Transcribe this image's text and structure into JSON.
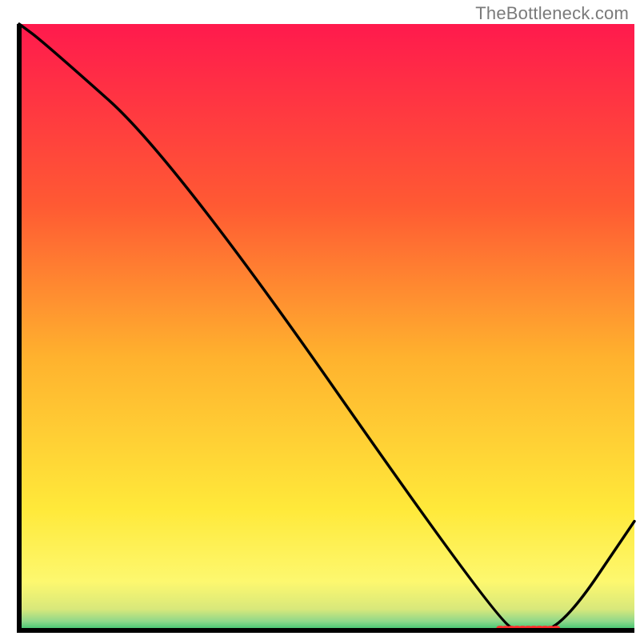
{
  "watermark": "TheBottleneck.com",
  "chart_data": {
    "type": "line",
    "title": "",
    "xlabel": "",
    "ylabel": "",
    "xlim": [
      0,
      100
    ],
    "ylim": [
      0,
      100
    ],
    "x": [
      0,
      4,
      25,
      78,
      82,
      88,
      100
    ],
    "y": [
      100,
      97,
      78,
      1,
      0,
      0,
      18
    ],
    "series": [
      {
        "name": "curve",
        "x": [
          0,
          4,
          25,
          78,
          82,
          88,
          100
        ],
        "y": [
          100,
          97,
          78,
          1,
          0,
          0,
          18
        ]
      }
    ],
    "highlight_band": {
      "x0": 78,
      "x1": 88,
      "y": 0.3
    },
    "gradient_stops": [
      {
        "pos": 0.0,
        "color": "#ff1a4d"
      },
      {
        "pos": 0.3,
        "color": "#ff5a33"
      },
      {
        "pos": 0.55,
        "color": "#ffb22e"
      },
      {
        "pos": 0.8,
        "color": "#ffe93a"
      },
      {
        "pos": 0.92,
        "color": "#fdf86f"
      },
      {
        "pos": 0.965,
        "color": "#d8e87b"
      },
      {
        "pos": 0.985,
        "color": "#8fd88a"
      },
      {
        "pos": 1.0,
        "color": "#36c36e"
      }
    ],
    "axis_stroke": "#000000",
    "plot_background": "gradient"
  }
}
